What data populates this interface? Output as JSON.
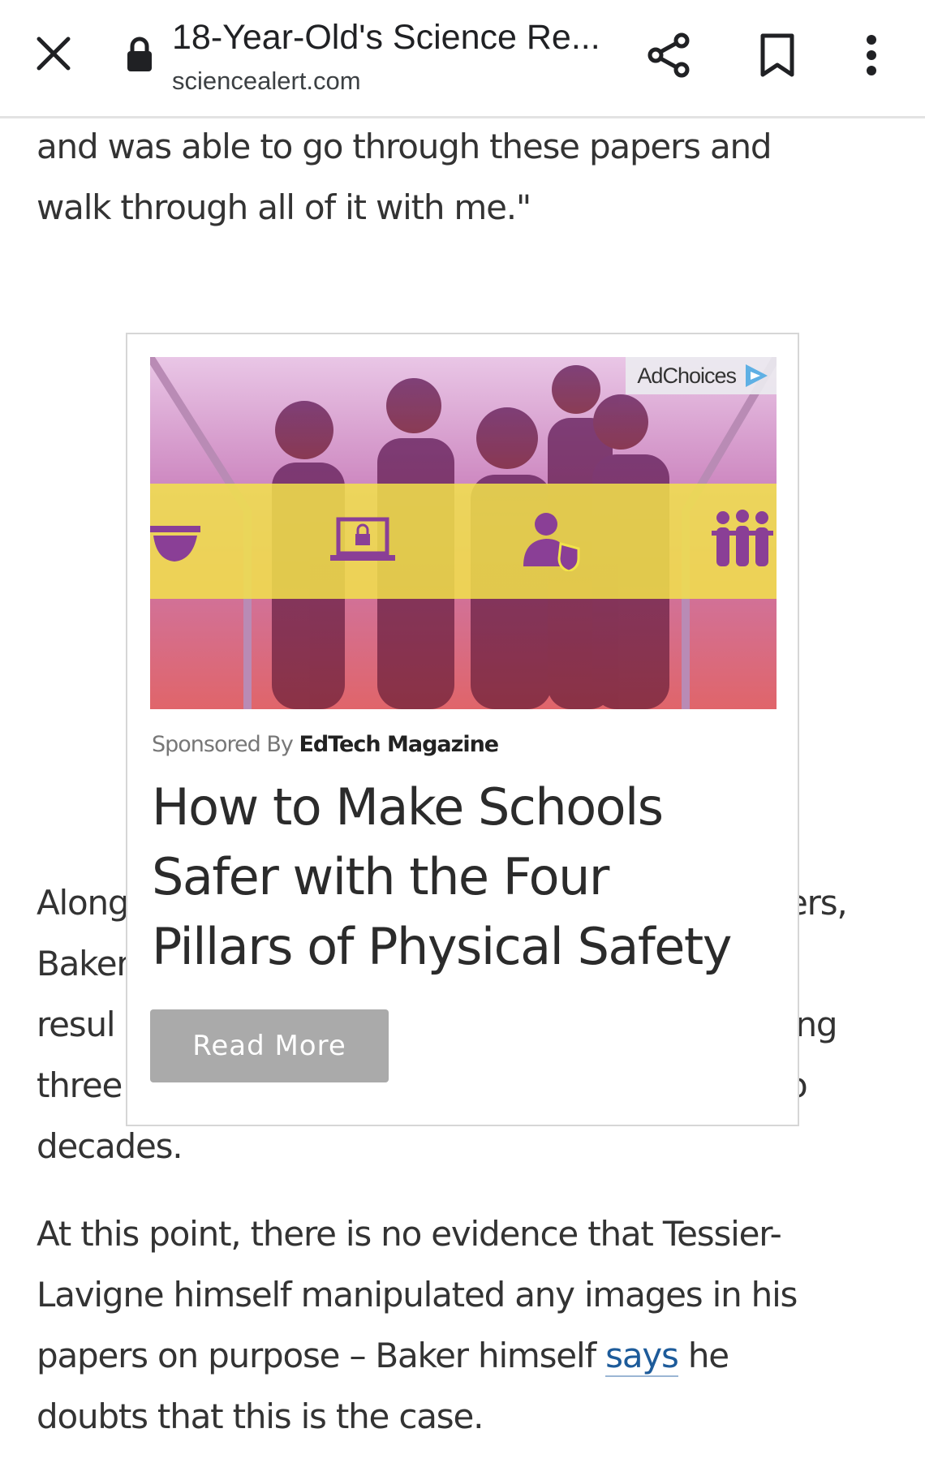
{
  "browser": {
    "title": "18-Year-Old's Science Re...",
    "domain": "sciencealert.com"
  },
  "article": {
    "top_lines": [
      "and was able to go through these papers and",
      "walk through all of it with me.\""
    ],
    "middle_left": [
      "Along",
      "Baker",
      "resul",
      "three",
      "decades."
    ],
    "middle_right": [
      "ers,",
      "",
      "ing",
      "o",
      ""
    ],
    "bottom_lines": [
      "At this point, there is no evidence that Tessier-",
      "Lavigne himself manipulated any images in his",
      "papers on purpose – Baker himself ",
      "doubts that this is the case."
    ],
    "link_text": "says",
    "after_link": " he"
  },
  "ad": {
    "adchoices": "AdChoices",
    "sponsored_by": "Sponsored By",
    "sponsor": "EdTech Magazine",
    "headline_lines": [
      "How to Make Schools",
      "Safer with the Four",
      "Pillars of Physical Safety"
    ],
    "cta": "Read More",
    "image_icons": [
      "camera-icon",
      "laptop-lock-icon",
      "user-shield-icon",
      "people-icon"
    ]
  },
  "colors": {
    "link": "#1d5b9a",
    "ad_band": "#f2e34a",
    "ad_button": "#aaaaaa"
  }
}
